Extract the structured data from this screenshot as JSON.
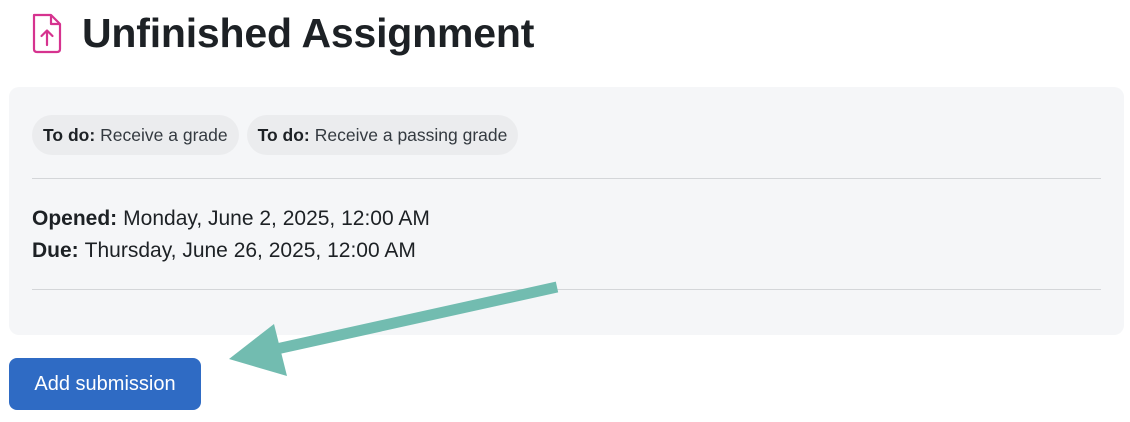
{
  "header": {
    "icon": "assignment-upload-icon",
    "title": "Unfinished Assignment"
  },
  "completion": {
    "items": [
      {
        "prefix": "To do:",
        "text": "Receive a grade"
      },
      {
        "prefix": "To do:",
        "text": "Receive a passing grade"
      }
    ]
  },
  "dates": {
    "opened_label": "Opened:",
    "opened_value": "Monday, June 2, 2025, 12:00 AM",
    "due_label": "Due:",
    "due_value": "Thursday, June 26, 2025, 12:00 AM"
  },
  "actions": {
    "add_submission_label": "Add submission"
  },
  "annotation": {
    "arrow_color": "#72bcb0",
    "arrow_points_to": "add-submission-button"
  },
  "colors": {
    "primary_button": "#2f6bc4",
    "icon_accent": "#d6338f",
    "panel_background": "#f5f6f8"
  }
}
